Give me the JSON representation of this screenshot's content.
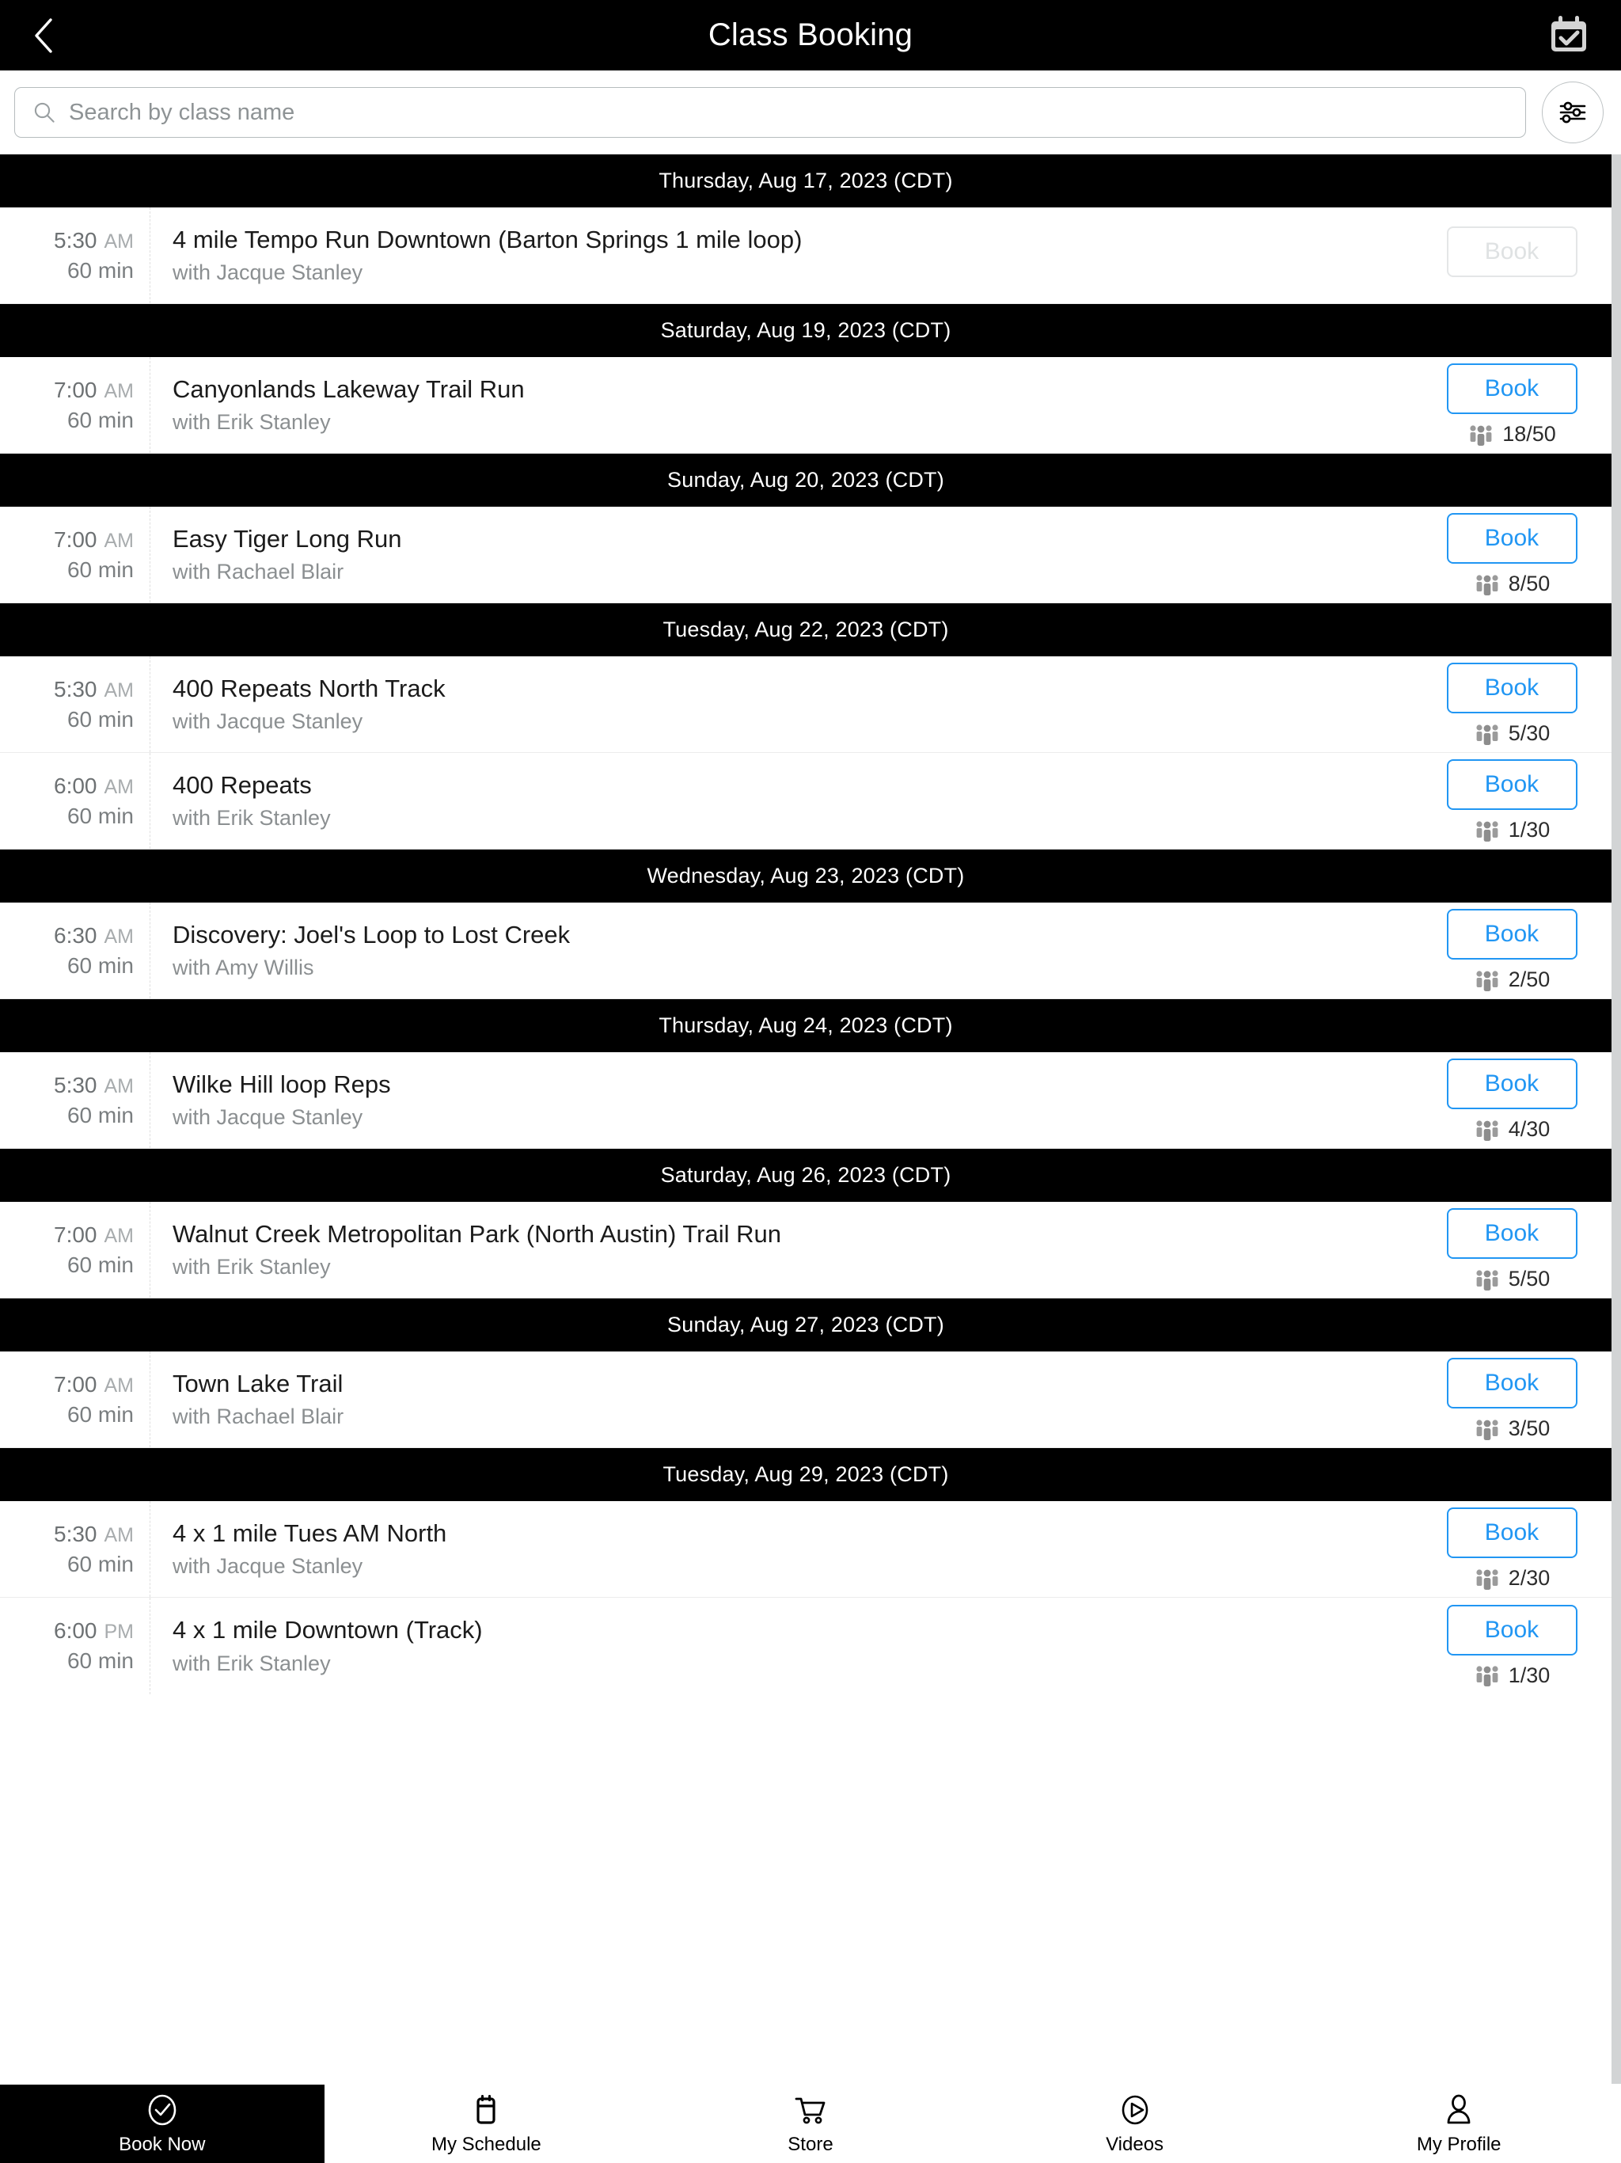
{
  "header": {
    "title": "Class Booking",
    "back_icon": "chevron-left-icon",
    "calendar_icon": "calendar-check-icon"
  },
  "search": {
    "placeholder": "Search by class name",
    "value": "",
    "icon": "search-icon",
    "filter_icon": "sliders-filter-icon"
  },
  "colors": {
    "accent": "#2196f3",
    "header_bg": "#000000",
    "disabled": "#dfe2e3",
    "muted_text": "#8b8f91"
  },
  "labels": {
    "book": "Book",
    "with_prefix": "with",
    "capacity_icon": "people-group-icon"
  },
  "groups": [
    {
      "date": "Thursday, Aug 17, 2023 (CDT)",
      "classes": [
        {
          "time": "5:30",
          "meridiem": "AM",
          "duration": "60 min",
          "name": "4 mile Tempo Run Downtown (Barton Springs 1 mile loop)",
          "instructor": "with Jacque Stanley",
          "book_label": "Book",
          "disabled": true,
          "capacity": ""
        }
      ]
    },
    {
      "date": "Saturday, Aug 19, 2023 (CDT)",
      "classes": [
        {
          "time": "7:00",
          "meridiem": "AM",
          "duration": "60 min",
          "name": "Canyonlands Lakeway Trail Run",
          "instructor": "with Erik Stanley",
          "book_label": "Book",
          "disabled": false,
          "capacity": "18/50"
        }
      ]
    },
    {
      "date": "Sunday, Aug 20, 2023 (CDT)",
      "classes": [
        {
          "time": "7:00",
          "meridiem": "AM",
          "duration": "60 min",
          "name": "Easy Tiger Long Run",
          "instructor": "with Rachael Blair",
          "book_label": "Book",
          "disabled": false,
          "capacity": "8/50"
        }
      ]
    },
    {
      "date": "Tuesday, Aug 22, 2023 (CDT)",
      "classes": [
        {
          "time": "5:30",
          "meridiem": "AM",
          "duration": "60 min",
          "name": "400 Repeats North Track",
          "instructor": "with Jacque Stanley",
          "book_label": "Book",
          "disabled": false,
          "capacity": "5/30"
        },
        {
          "time": "6:00",
          "meridiem": "AM",
          "duration": "60 min",
          "name": "400 Repeats",
          "instructor": "with Erik Stanley",
          "book_label": "Book",
          "disabled": false,
          "capacity": "1/30"
        }
      ]
    },
    {
      "date": "Wednesday, Aug 23, 2023 (CDT)",
      "classes": [
        {
          "time": "6:30",
          "meridiem": "AM",
          "duration": "60 min",
          "name": "Discovery: Joel's Loop to Lost Creek",
          "instructor": "with Amy Willis",
          "book_label": "Book",
          "disabled": false,
          "capacity": "2/50"
        }
      ]
    },
    {
      "date": "Thursday, Aug 24, 2023 (CDT)",
      "classes": [
        {
          "time": "5:30",
          "meridiem": "AM",
          "duration": "60 min",
          "name": "Wilke Hill loop Reps",
          "instructor": "with Jacque Stanley",
          "book_label": "Book",
          "disabled": false,
          "capacity": "4/30"
        }
      ]
    },
    {
      "date": "Saturday, Aug 26, 2023 (CDT)",
      "classes": [
        {
          "time": "7:00",
          "meridiem": "AM",
          "duration": "60 min",
          "name": "Walnut Creek Metropolitan Park (North Austin) Trail Run",
          "instructor": "with Erik Stanley",
          "book_label": "Book",
          "disabled": false,
          "capacity": "5/50"
        }
      ]
    },
    {
      "date": "Sunday, Aug 27, 2023 (CDT)",
      "classes": [
        {
          "time": "7:00",
          "meridiem": "AM",
          "duration": "60 min",
          "name": "Town Lake Trail",
          "instructor": "with Rachael Blair",
          "book_label": "Book",
          "disabled": false,
          "capacity": "3/50"
        }
      ]
    },
    {
      "date": "Tuesday, Aug 29, 2023 (CDT)",
      "classes": [
        {
          "time": "5:30",
          "meridiem": "AM",
          "duration": "60 min",
          "name": "4 x 1 mile Tues AM North",
          "instructor": "with Jacque Stanley",
          "book_label": "Book",
          "disabled": false,
          "capacity": "2/30"
        },
        {
          "time": "6:00",
          "meridiem": "PM",
          "duration": "60 min",
          "name": "4 x 1 mile Downtown (Track)",
          "instructor": "with Erik Stanley",
          "book_label": "Book",
          "disabled": false,
          "capacity": "1/30"
        }
      ]
    }
  ],
  "bottom_nav": {
    "items": [
      {
        "label": "Book Now",
        "icon": "check-circle-icon",
        "active": true
      },
      {
        "label": "My Schedule",
        "icon": "calendar-icon",
        "active": false
      },
      {
        "label": "Store",
        "icon": "shopping-cart-icon",
        "active": false
      },
      {
        "label": "Videos",
        "icon": "play-circle-icon",
        "active": false
      },
      {
        "label": "My Profile",
        "icon": "user-icon",
        "active": false
      }
    ]
  }
}
